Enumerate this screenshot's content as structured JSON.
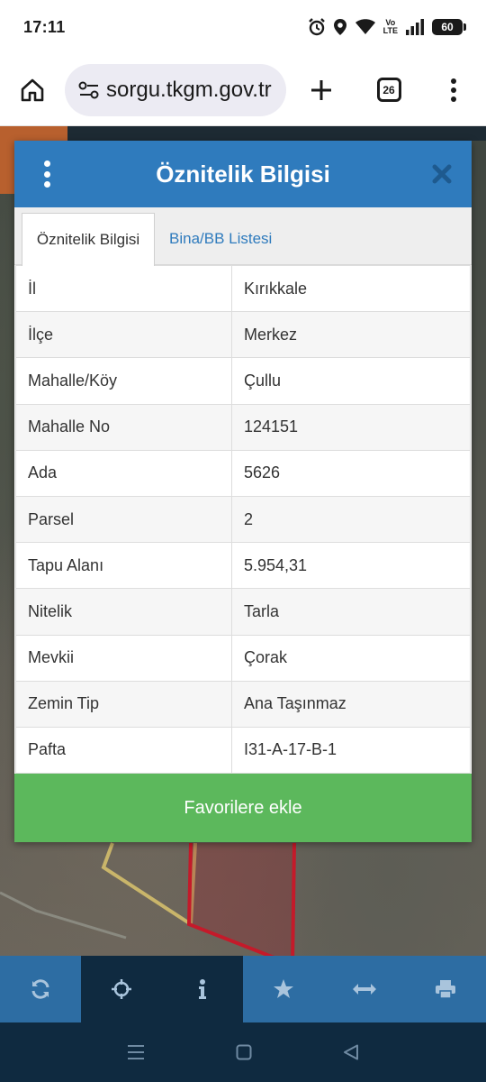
{
  "status": {
    "time": "17:11",
    "battery": "60",
    "volte_top": "Vo",
    "volte_bottom": "LTE"
  },
  "browser": {
    "url": "sorgu.tkgm.gov.tr",
    "tab_count": "26"
  },
  "panel": {
    "title": "Öznitelik Bilgisi",
    "tabs": [
      {
        "label": "Öznitelik Bilgisi"
      },
      {
        "label": "Bina/BB Listesi"
      }
    ],
    "rows": [
      {
        "key": "İl",
        "value": "Kırıkkale"
      },
      {
        "key": "İlçe",
        "value": "Merkez"
      },
      {
        "key": "Mahalle/Köy",
        "value": "Çullu"
      },
      {
        "key": "Mahalle No",
        "value": "124151"
      },
      {
        "key": "Ada",
        "value": "5626"
      },
      {
        "key": "Parsel",
        "value": "2"
      },
      {
        "key": "Tapu Alanı",
        "value": "5.954,31"
      },
      {
        "key": "Nitelik",
        "value": "Tarla"
      },
      {
        "key": "Mevkii",
        "value": "Çorak"
      },
      {
        "key": "Zemin Tip",
        "value": "Ana Taşınmaz"
      },
      {
        "key": "Pafta",
        "value": "I31-A-17-B-1"
      }
    ],
    "favorite_label": "Favorilere ekle"
  },
  "toolbar": {
    "icons": [
      "refresh-icon",
      "crosshair-icon",
      "info-icon",
      "star-icon",
      "measure-icon",
      "print-icon"
    ],
    "active_index": 1
  },
  "colors": {
    "header": "#2f7bbd",
    "favorite": "#5cb85c",
    "toolbar": "#2d6da3",
    "toolbar_active": "#0f2a40"
  }
}
